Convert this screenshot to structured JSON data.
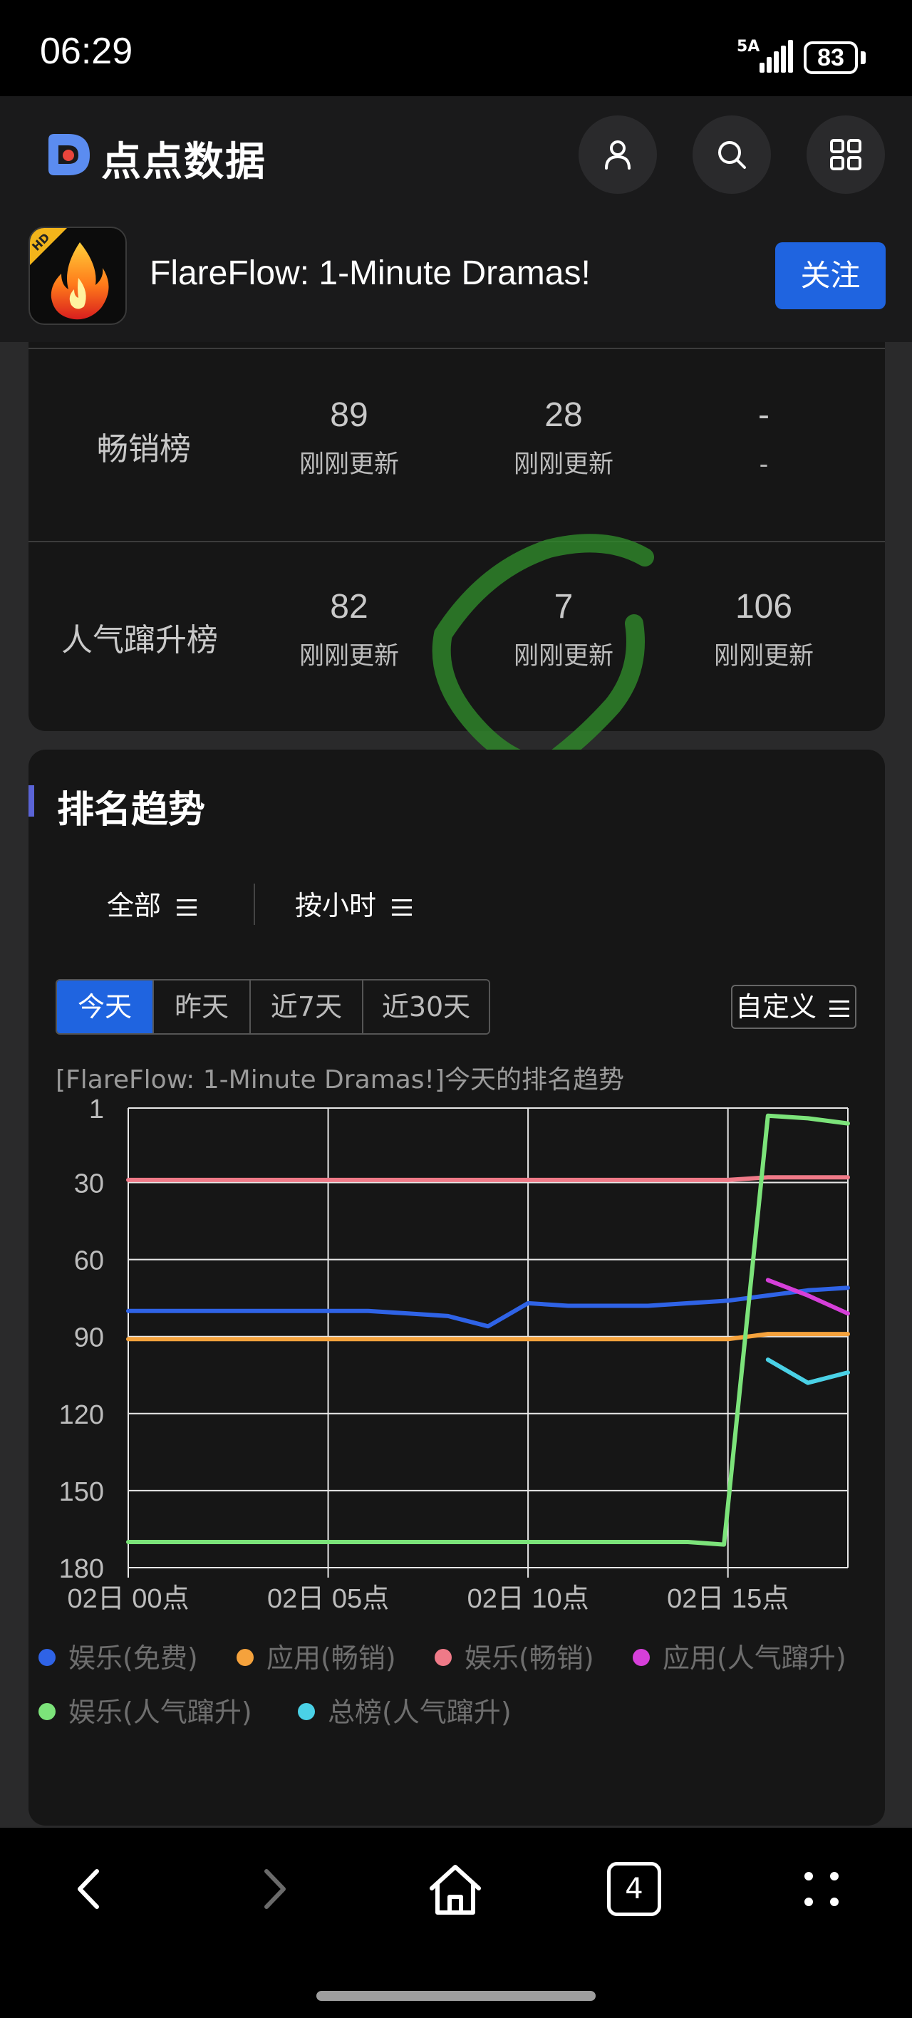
{
  "status_bar": {
    "time": "06:29",
    "network": "5A",
    "battery": "83"
  },
  "header": {
    "brand": "点点数据",
    "app_name": "FlareFlow: 1-Minute Dramas!",
    "app_icon_badge": "HD",
    "follow_label": "关注"
  },
  "rank_table": {
    "rows": [
      {
        "label": "畅销榜",
        "cells": [
          {
            "value": "89",
            "status": "刚刚更新"
          },
          {
            "value": "28",
            "status": "刚刚更新"
          },
          {
            "value": "-",
            "status": "-"
          }
        ]
      },
      {
        "label": "人气蹿升榜",
        "cells": [
          {
            "value": "82",
            "status": "刚刚更新"
          },
          {
            "value": "7",
            "status": "刚刚更新"
          },
          {
            "value": "106",
            "status": "刚刚更新"
          }
        ]
      }
    ]
  },
  "trend": {
    "section_title": "排名趋势",
    "filter_all": "全部",
    "filter_interval": "按小时",
    "tabs": [
      "今天",
      "昨天",
      "近7天",
      "近30天"
    ],
    "active_tab": "今天",
    "custom_label": "自定义",
    "chart_title": "[FlareFlow: 1-Minute Dramas!]今天的排名趋势"
  },
  "chart_data": {
    "type": "line",
    "title": "[FlareFlow: 1-Minute Dramas!]今天的排名趋势",
    "x": [
      0,
      1,
      2,
      3,
      4,
      5,
      6,
      7,
      8,
      9,
      10,
      11,
      12,
      13,
      14,
      15,
      16,
      17,
      18
    ],
    "x_tick_values": [
      0,
      5,
      10,
      15
    ],
    "x_tick_labels": [
      "02日 00点",
      "02日 05点",
      "02日 10点",
      "02日 15点"
    ],
    "y_ticks": [
      1,
      30,
      60,
      90,
      120,
      150,
      180
    ],
    "ylim": [
      1,
      180
    ],
    "y_reversed": true,
    "grid": true,
    "legend_position": "bottom",
    "series": [
      {
        "name": "娱乐(免费)",
        "color": "#2f63e6",
        "x": [
          0,
          1,
          2,
          3,
          4,
          5,
          6,
          7,
          8,
          9,
          10,
          11,
          12,
          13,
          14,
          15,
          16,
          17,
          18
        ],
        "y": [
          80,
          80,
          80,
          80,
          80,
          80,
          80,
          81,
          82,
          86,
          77,
          78,
          78,
          78,
          77,
          76,
          74,
          72,
          71
        ]
      },
      {
        "name": "应用(畅销)",
        "color": "#f5a23c",
        "x": [
          0,
          1,
          2,
          3,
          4,
          5,
          6,
          7,
          8,
          9,
          10,
          11,
          12,
          13,
          14,
          15,
          16,
          17,
          18
        ],
        "y": [
          91,
          91,
          91,
          91,
          91,
          91,
          91,
          91,
          91,
          91,
          91,
          91,
          91,
          91,
          91,
          91,
          89,
          89,
          89
        ]
      },
      {
        "name": "娱乐(畅销)",
        "color": "#ef7a88",
        "x": [
          0,
          1,
          2,
          3,
          4,
          5,
          6,
          7,
          8,
          9,
          10,
          11,
          12,
          13,
          14,
          15,
          16,
          17,
          18
        ],
        "y": [
          29,
          29,
          29,
          29,
          29,
          29,
          29,
          29,
          29,
          29,
          29,
          29,
          29,
          29,
          29,
          29,
          28,
          28,
          28
        ]
      },
      {
        "name": "应用(人气蹿升)",
        "color": "#d63fd9",
        "x": [
          16,
          17,
          18
        ],
        "y": [
          68,
          74,
          81
        ]
      },
      {
        "name": "娱乐(人气蹿升)",
        "color": "#7ce37a",
        "x": [
          0,
          1,
          2,
          3,
          4,
          5,
          6,
          7,
          8,
          9,
          10,
          11,
          12,
          13,
          14,
          14.9,
          16,
          17,
          18
        ],
        "y": [
          170,
          170,
          170,
          170,
          170,
          170,
          170,
          170,
          170,
          170,
          170,
          170,
          170,
          170,
          170,
          171,
          4,
          5,
          7
        ]
      },
      {
        "name": "总榜(人气蹿升)",
        "color": "#4ad1e6",
        "x": [
          16,
          17,
          18
        ],
        "y": [
          99,
          108,
          104
        ]
      }
    ]
  },
  "nav": {
    "tab_count": "4"
  }
}
